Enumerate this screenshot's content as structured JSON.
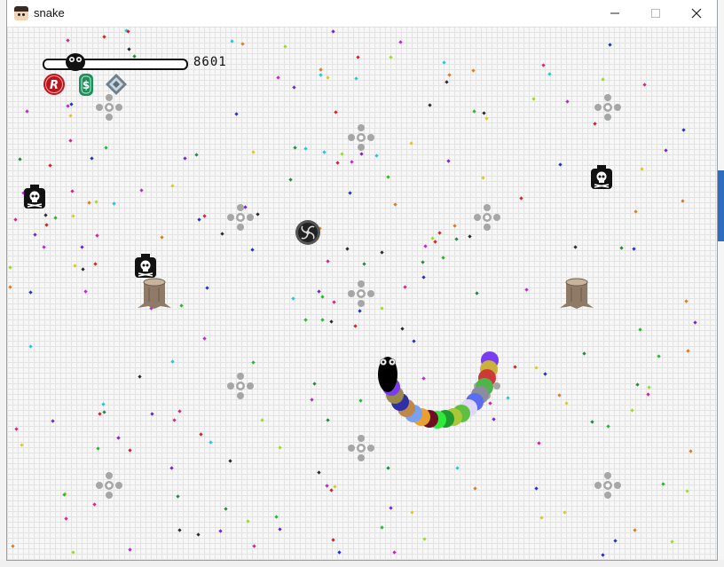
{
  "window": {
    "title": "snake",
    "minimize_icon": "minimize-icon",
    "maximize_icon": "maximize-icon",
    "close_icon": "close-icon"
  },
  "hud": {
    "score": "8601",
    "powerups": [
      {
        "name": "red-r-badge",
        "letter": "R",
        "color": "#c0141c"
      },
      {
        "name": "green-dollar-badge",
        "letter": "$",
        "color": "#1e8f5c"
      },
      {
        "name": "diamond-badge",
        "letter": "",
        "color": "#8aa4b8"
      }
    ]
  },
  "colors": {
    "snake_head": "#000000",
    "segment_palette": [
      "#7a3cf0",
      "#c9b13a",
      "#d03838",
      "#4fb54a",
      "#8c8ca0",
      "#5a6cf0",
      "#e0d8f8",
      "#5fbf3f",
      "#a8c83a",
      "#1f9a2f",
      "#32e83a",
      "#6d0f24",
      "#e9a030",
      "#7aa0f0",
      "#c08848",
      "#2f2fa8",
      "#9a8a4a"
    ]
  }
}
